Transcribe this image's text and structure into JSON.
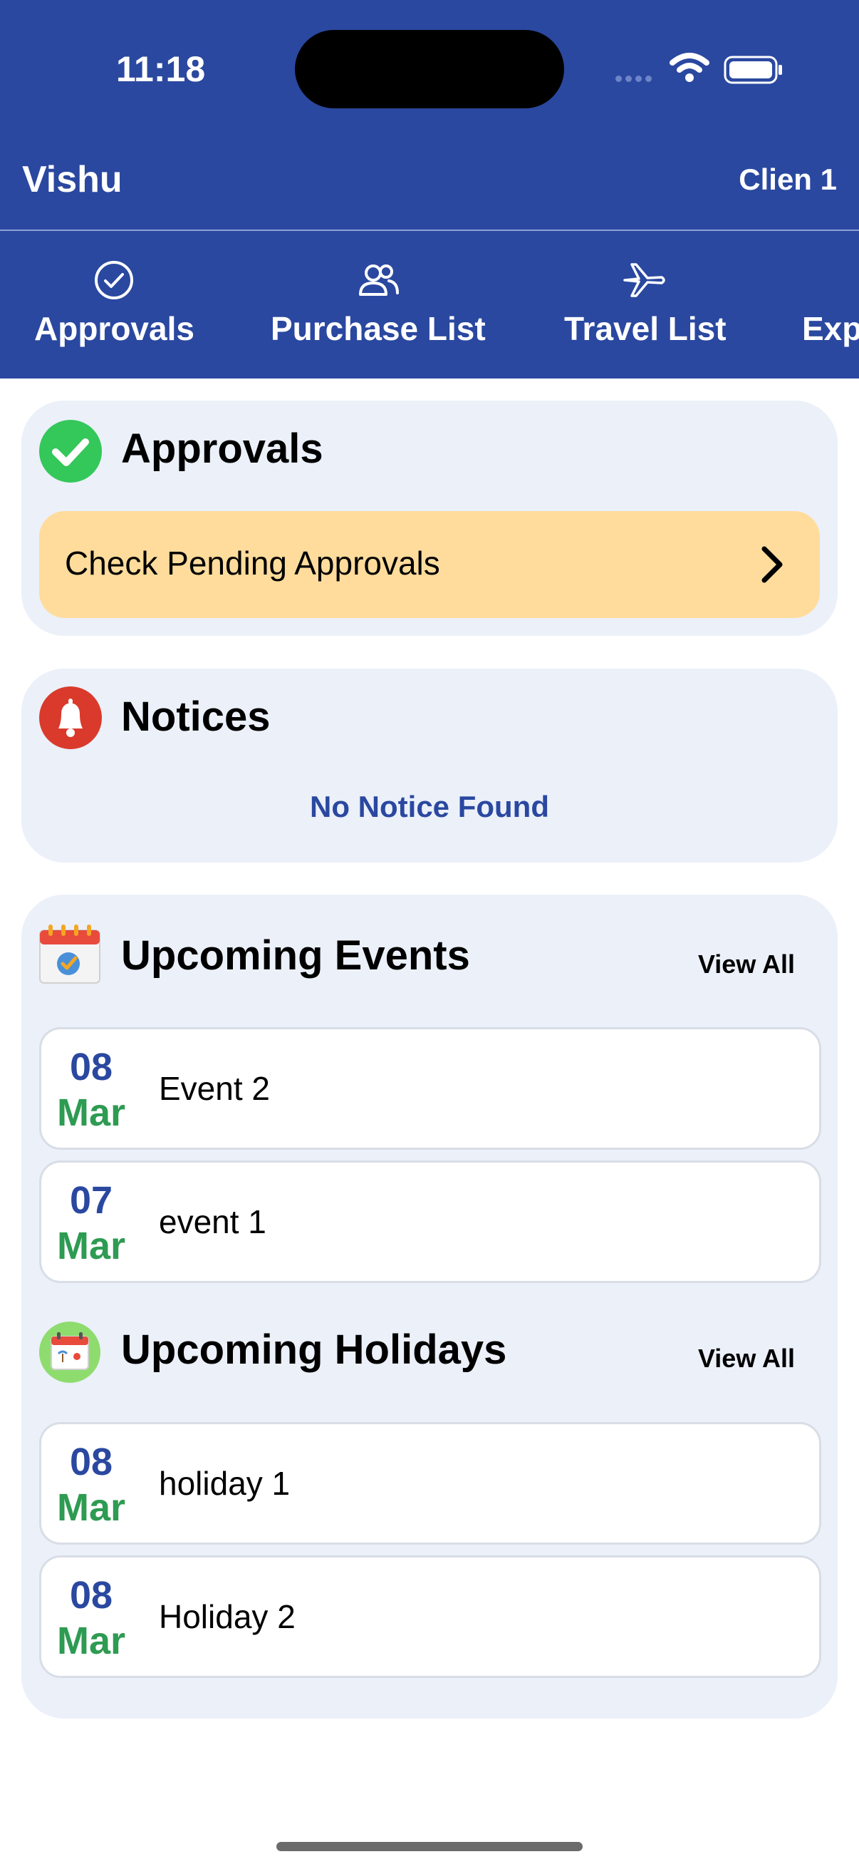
{
  "status_bar": {
    "time": "11:18"
  },
  "header": {
    "title": "Vishu",
    "client": "Clien 1"
  },
  "tabs": [
    {
      "label": "Approvals",
      "icon": "check-circle-icon"
    },
    {
      "label": "Purchase List",
      "icon": "users-icon"
    },
    {
      "label": "Travel List",
      "icon": "airplane-icon"
    },
    {
      "label": "Exp",
      "icon": "none"
    }
  ],
  "approvals": {
    "title": "Approvals",
    "icon": "green-check-badge-icon",
    "pending_label": "Check Pending Approvals"
  },
  "notices": {
    "title": "Notices",
    "icon": "bell-icon",
    "empty_text": "No Notice Found"
  },
  "events": {
    "title": "Upcoming Events",
    "view_all": "View All",
    "icon": "calendar-icon",
    "items": [
      {
        "day": "08",
        "month": "Mar",
        "name": "Event 2"
      },
      {
        "day": "07",
        "month": "Mar",
        "name": "event 1"
      }
    ]
  },
  "holidays": {
    "title": "Upcoming Holidays",
    "view_all": "View All",
    "icon": "holiday-calendar-icon",
    "items": [
      {
        "day": "08",
        "month": "Mar",
        "name": "holiday 1"
      },
      {
        "day": "08",
        "month": "Mar",
        "name": "Holiday 2"
      }
    ]
  },
  "colors": {
    "primary": "#2a48a0",
    "card_bg": "#ebf0f9",
    "pending_bg": "#ffdc9c",
    "month_green": "#2e9b52"
  }
}
